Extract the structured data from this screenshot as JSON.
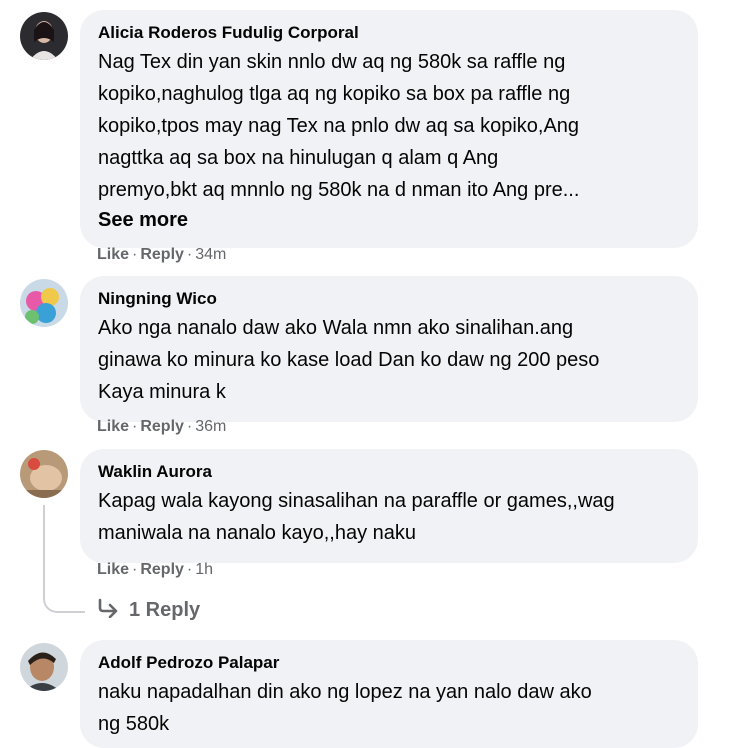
{
  "comments": [
    {
      "author": "Alicia Roderos Fudulig Corporal",
      "text": "Nag Tex din yan skin nnlo dw aq ng 580k sa raffle ng\nkopiko,naghulog tlga aq ng kopiko sa box pa raffle ng\nkopiko,tpos may nag Tex na pnlo dw aq sa kopiko,Ang\nnagttka aq sa box na hinulugan q alam q Ang\npremyo,bkt aq mnnlo ng 580k na d nman ito Ang pre...",
      "see_more": "See more",
      "like": "Like",
      "reply": "Reply",
      "time": "34m"
    },
    {
      "author": "Ningning Wico",
      "text": "Ako nga nanalo daw ako Wala nmn ako sinalihan.ang\nginawa ko minura ko kase load Dan ko daw ng 200 peso\nKaya minura k",
      "like": "Like",
      "reply": "Reply",
      "time": "36m"
    },
    {
      "author": "Waklin Aurora",
      "text": "Kapag wala kayong sinasalihan na paraffle or games,,wag\nmaniwala na nanalo kayo,,hay naku",
      "like": "Like",
      "reply": "Reply",
      "time": "1h",
      "replies_label": "1 Reply"
    },
    {
      "author": "Adolf Pedrozo Palapar",
      "text": "naku napadalhan din ako ng lopez na yan nalo daw ako\nng 580k"
    }
  ],
  "separator": "·",
  "colors": {
    "bubble": "#f0f2f5",
    "secondary_text": "#65676b",
    "primary_text": "#050505",
    "thread_line": "#ced0d4"
  },
  "icons": {
    "reply_arrow": "reply-arrow-icon"
  }
}
